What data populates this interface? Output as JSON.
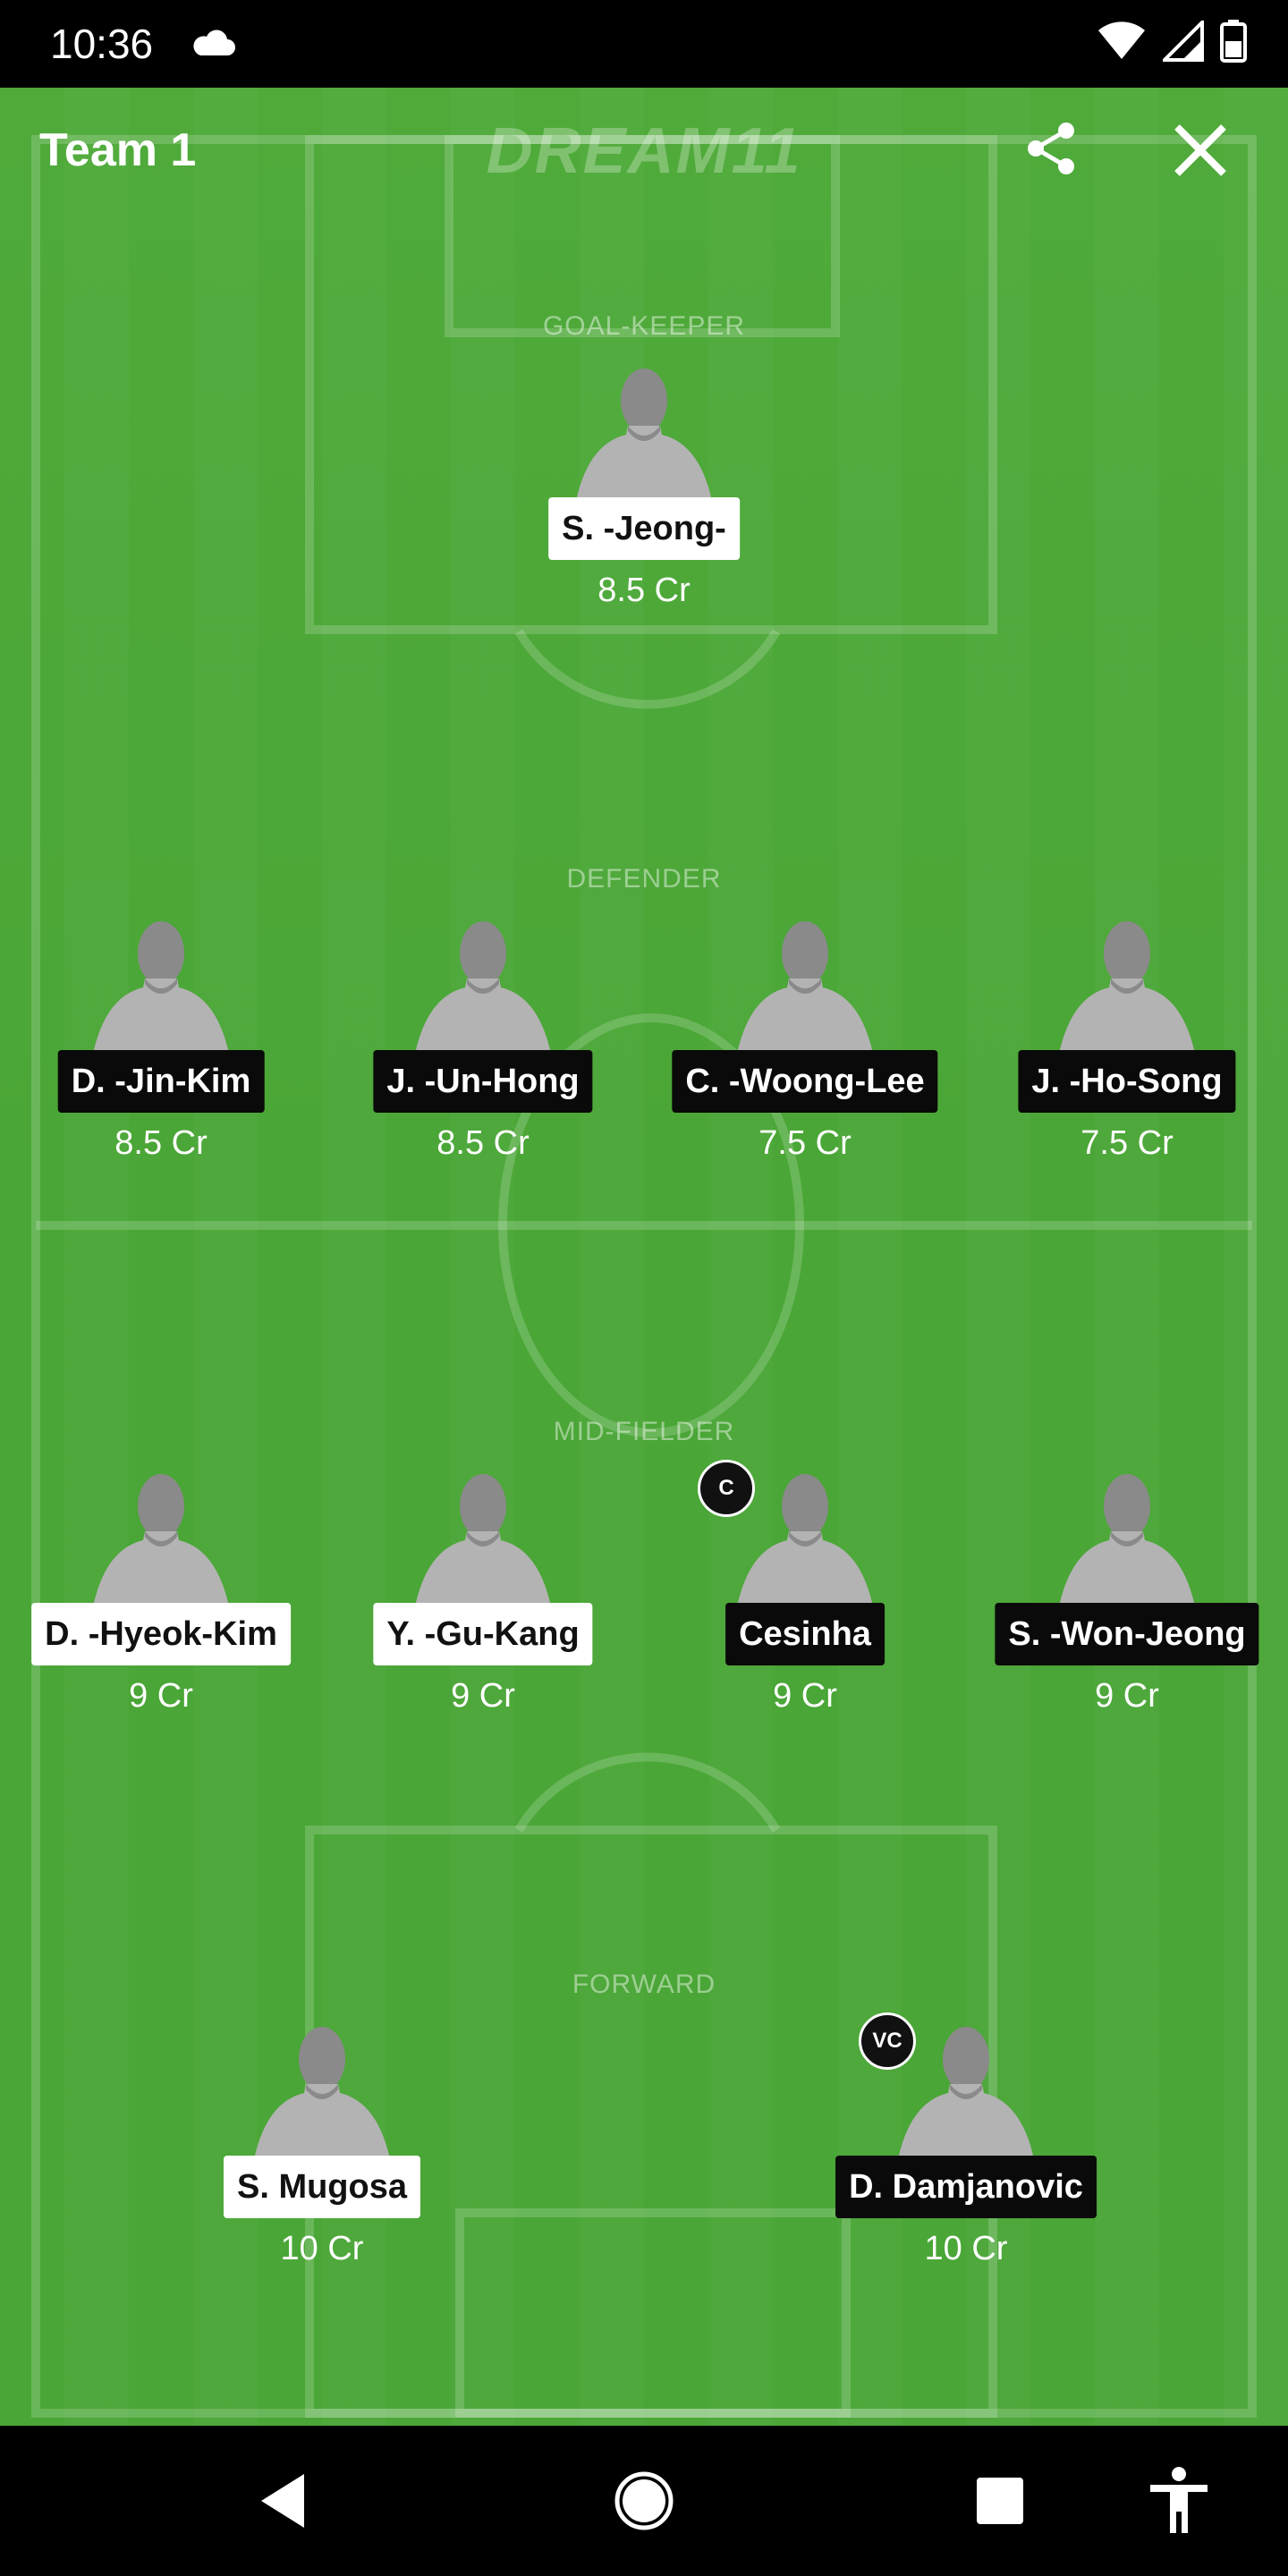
{
  "status_bar": {
    "time": "10:36",
    "icons": [
      "cloud-icon",
      "wifi-icon",
      "signal-icon",
      "battery-icon"
    ]
  },
  "header": {
    "team_name": "Team 1",
    "brand": "DREAM11",
    "share_icon": "share-icon",
    "close_icon": "close-icon"
  },
  "sections": {
    "goalkeeper": "GOAL-KEEPER",
    "defender": "DEFENDER",
    "midfielder": "MID-FIELDER",
    "forward": "FORWARD"
  },
  "players": {
    "gk": [
      {
        "name": "S. -Jeong-",
        "price": "8.5 Cr"
      }
    ],
    "def": [
      {
        "name": "D. -Jin-Kim",
        "price": "8.5 Cr"
      },
      {
        "name": "J. -Un-Hong",
        "price": "8.5 Cr"
      },
      {
        "name": "C. -Woong-Lee",
        "price": "7.5 Cr"
      },
      {
        "name": "J. -Ho-Song",
        "price": "7.5 Cr"
      }
    ],
    "mid": [
      {
        "name": "D. -Hyeok-Kim",
        "price": "9 Cr"
      },
      {
        "name": "Y. -Gu-Kang",
        "price": "9 Cr"
      },
      {
        "name": "Cesinha",
        "price": "9 Cr",
        "badge": "C"
      },
      {
        "name": "S. -Won-Jeong",
        "price": "9 Cr"
      }
    ],
    "fwd": [
      {
        "name": "S. Mugosa",
        "price": "10 Cr"
      },
      {
        "name": "D. Damjanovic",
        "price": "10 Cr",
        "badge": "VC"
      }
    ]
  },
  "nav": [
    "back-icon",
    "home-icon",
    "recents-icon",
    "accessibility-icon"
  ],
  "colors": {
    "pitch": "#4aa636",
    "dark_label": "#0a0a0a",
    "light_label": "#ffffff"
  }
}
